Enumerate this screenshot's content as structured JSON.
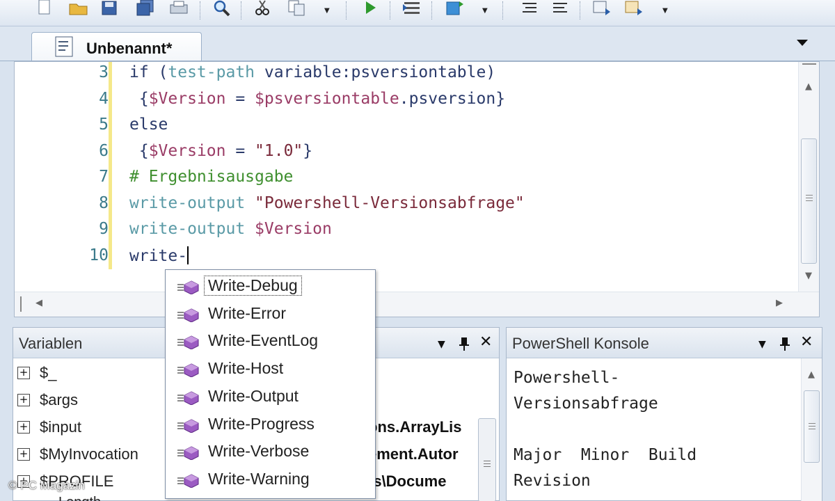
{
  "tab": {
    "title": "Unbenannt*"
  },
  "editor": {
    "line_numbers": [
      "3",
      "4",
      "5",
      "6",
      "7",
      "8",
      "9",
      "10"
    ],
    "lines": [
      [
        {
          "t": "if (",
          "c": "kw"
        },
        {
          "t": "test-path",
          "c": "cmd"
        },
        {
          "t": " variable:psversiontable)",
          "c": "kw"
        }
      ],
      [
        {
          "t": " {",
          "c": "kw"
        },
        {
          "t": "$Version",
          "c": "var"
        },
        {
          "t": " = ",
          "c": "kw"
        },
        {
          "t": "$psversiontable",
          "c": "var"
        },
        {
          "t": ".psversion}",
          "c": "kw"
        }
      ],
      [
        {
          "t": "else",
          "c": "kw"
        }
      ],
      [
        {
          "t": " {",
          "c": "kw"
        },
        {
          "t": "$Version",
          "c": "var"
        },
        {
          "t": " = ",
          "c": "kw"
        },
        {
          "t": "\"1.0\"",
          "c": "str"
        },
        {
          "t": "}",
          "c": "kw"
        }
      ],
      [
        {
          "t": "# Ergebnisausgabe",
          "c": "com"
        }
      ],
      [
        {
          "t": "write-output",
          "c": "cmd"
        },
        {
          "t": " ",
          "c": "kw"
        },
        {
          "t": "\"Powershell-Versionsabfrage\"",
          "c": "str"
        }
      ],
      [
        {
          "t": "write-output",
          "c": "cmd"
        },
        {
          "t": " ",
          "c": "kw"
        },
        {
          "t": "$Version",
          "c": "var"
        }
      ],
      [
        {
          "t": "write-",
          "c": "kw"
        }
      ]
    ]
  },
  "autocomplete": {
    "items": [
      "Write-Debug",
      "Write-Error",
      "Write-EventLog",
      "Write-Host",
      "Write-Output",
      "Write-Progress",
      "Write-Verbose",
      "Write-Warning"
    ],
    "selected": 0,
    "icon": "cmdlet-icon"
  },
  "variables_panel": {
    "title": "Variablen",
    "rows": [
      {
        "name": "$_",
        "value": ""
      },
      {
        "name": "$args",
        "value": ""
      },
      {
        "name": "$input",
        "value": "ons.ArrayLis"
      },
      {
        "name": "$MyInvocation",
        "value": "ement.Autor"
      },
      {
        "name": "$PROFILE",
        "value": "ts\\Docume"
      }
    ],
    "partial_row": "Length"
  },
  "console_panel": {
    "title": "PowerShell Konsole",
    "output": "Powershell-\nVersionsabfrage\n\nMajor  Minor  Build\nRevision"
  },
  "watermark": "© PC Magazin",
  "colors": {
    "keyword": "#2a3a6a",
    "cmdlet": "#5a9aa6",
    "variable": "#9a3c66",
    "string": "#7a2a3a",
    "comment": "#3f8f2f",
    "line_number": "#3a7a8a"
  }
}
